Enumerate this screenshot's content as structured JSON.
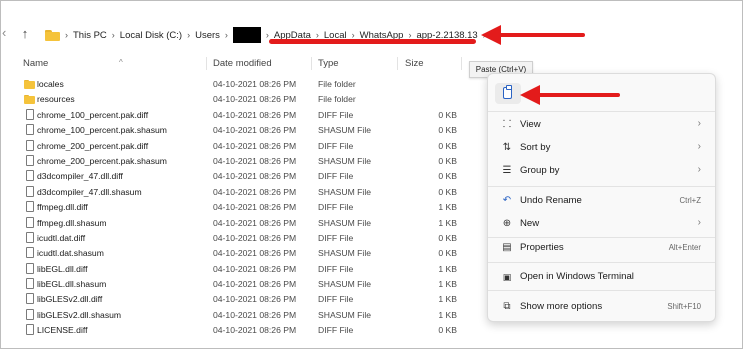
{
  "address_bar": {
    "crumbs": [
      "This PC",
      "Local Disk (C:)",
      "Users",
      "AppData",
      "Local",
      "WhatsApp",
      "app-2.2138.13"
    ]
  },
  "columns": {
    "name": "Name",
    "date": "Date modified",
    "type": "Type",
    "size": "Size"
  },
  "files": [
    {
      "kind": "folder",
      "name": "locales",
      "date": "04-10-2021 08:26 PM",
      "type": "File folder",
      "size": ""
    },
    {
      "kind": "folder",
      "name": "resources",
      "date": "04-10-2021 08:26 PM",
      "type": "File folder",
      "size": ""
    },
    {
      "kind": "file",
      "name": "chrome_100_percent.pak.diff",
      "date": "04-10-2021 08:26 PM",
      "type": "DIFF File",
      "size": "0 KB"
    },
    {
      "kind": "file",
      "name": "chrome_100_percent.pak.shasum",
      "date": "04-10-2021 08:26 PM",
      "type": "SHASUM File",
      "size": "0 KB"
    },
    {
      "kind": "file",
      "name": "chrome_200_percent.pak.diff",
      "date": "04-10-2021 08:26 PM",
      "type": "DIFF File",
      "size": "0 KB"
    },
    {
      "kind": "file",
      "name": "chrome_200_percent.pak.shasum",
      "date": "04-10-2021 08:26 PM",
      "type": "SHASUM File",
      "size": "0 KB"
    },
    {
      "kind": "file",
      "name": "d3dcompiler_47.dll.diff",
      "date": "04-10-2021 08:26 PM",
      "type": "DIFF File",
      "size": "0 KB"
    },
    {
      "kind": "file",
      "name": "d3dcompiler_47.dll.shasum",
      "date": "04-10-2021 08:26 PM",
      "type": "SHASUM File",
      "size": "0 KB"
    },
    {
      "kind": "file",
      "name": "ffmpeg.dll.diff",
      "date": "04-10-2021 08:26 PM",
      "type": "DIFF File",
      "size": "1 KB"
    },
    {
      "kind": "file",
      "name": "ffmpeg.dll.shasum",
      "date": "04-10-2021 08:26 PM",
      "type": "SHASUM File",
      "size": "1 KB"
    },
    {
      "kind": "file",
      "name": "icudtl.dat.diff",
      "date": "04-10-2021 08:26 PM",
      "type": "DIFF File",
      "size": "0 KB"
    },
    {
      "kind": "file",
      "name": "icudtl.dat.shasum",
      "date": "04-10-2021 08:26 PM",
      "type": "SHASUM File",
      "size": "0 KB"
    },
    {
      "kind": "file",
      "name": "libEGL.dll.diff",
      "date": "04-10-2021 08:26 PM",
      "type": "DIFF File",
      "size": "1 KB"
    },
    {
      "kind": "file",
      "name": "libEGL.dll.shasum",
      "date": "04-10-2021 08:26 PM",
      "type": "SHASUM File",
      "size": "1 KB"
    },
    {
      "kind": "file",
      "name": "libGLESv2.dll.diff",
      "date": "04-10-2021 08:26 PM",
      "type": "DIFF File",
      "size": "1 KB"
    },
    {
      "kind": "file",
      "name": "libGLESv2.dll.shasum",
      "date": "04-10-2021 08:26 PM",
      "type": "SHASUM File",
      "size": "1 KB"
    },
    {
      "kind": "file",
      "name": "LICENSE.diff",
      "date": "04-10-2021 08:26 PM",
      "type": "DIFF File",
      "size": "0 KB"
    }
  ],
  "tooltip": {
    "text": "Paste (Ctrl+V)"
  },
  "context_menu": {
    "view": "View",
    "sort_by": "Sort by",
    "group_by": "Group by",
    "undo": "Undo Rename",
    "undo_shortcut": "Ctrl+Z",
    "new": "New",
    "properties": "Properties",
    "properties_shortcut": "Alt+Enter",
    "terminal": "Open in Windows Terminal",
    "more_options": "Show more options",
    "more_options_shortcut": "Shift+F10"
  },
  "colors": {
    "annotation_red": "#e31b1b",
    "folder_yellow": "#f5c33b",
    "accent_blue": "#2a63c4"
  }
}
